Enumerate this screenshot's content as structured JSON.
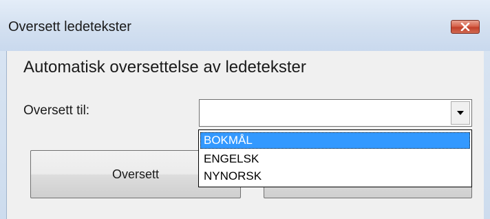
{
  "window": {
    "title": "Oversett ledetekster",
    "close_icon": "close-icon"
  },
  "dialog": {
    "heading": "Automatisk oversettelse av ledetekster",
    "translate_to_label": "Oversett til:",
    "combo": {
      "value": "",
      "arrow_icon": "chevron-down-icon",
      "options": [
        "BOKMÅL",
        "ENGELSK",
        "NYNORSK"
      ],
      "highlighted_option": "BOKMÅL"
    },
    "buttons": {
      "translate_label": "Oversett",
      "second_label": ""
    }
  },
  "colors": {
    "selection": "#3399ff",
    "close_button": "#c2402a",
    "title_bar": "#d3e0f0"
  }
}
